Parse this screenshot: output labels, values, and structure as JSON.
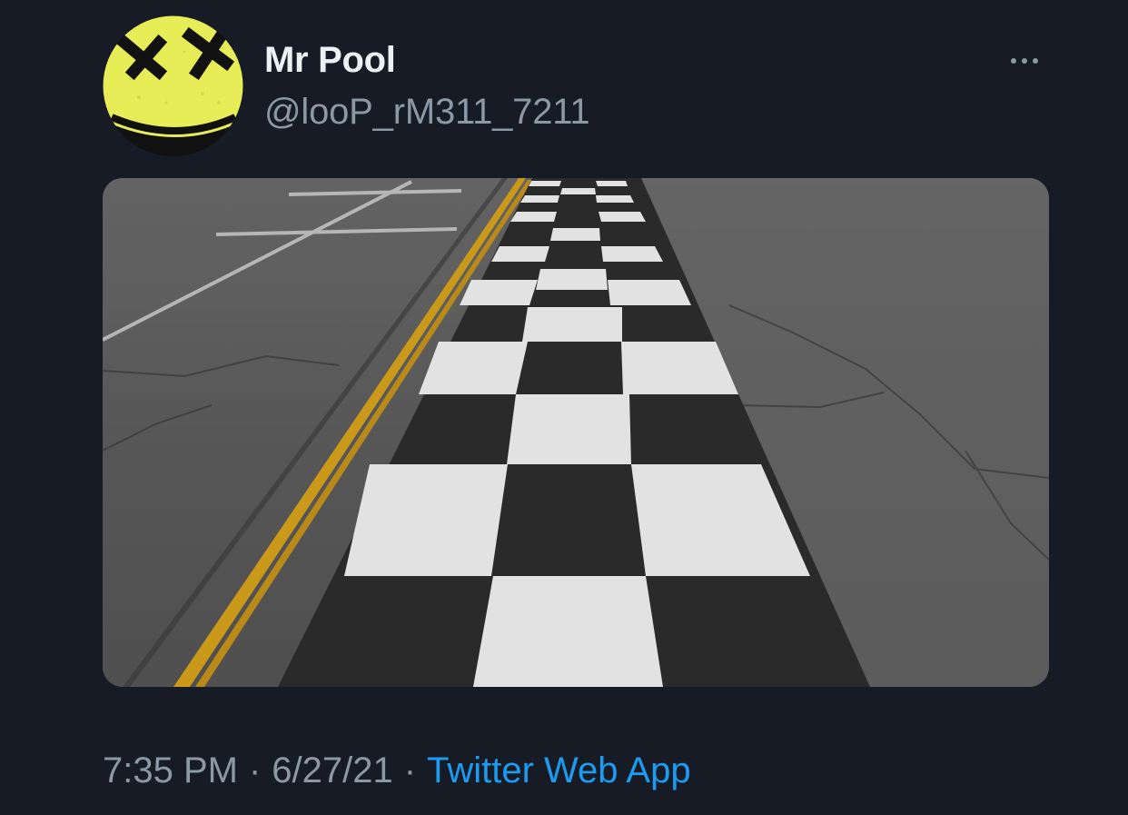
{
  "tweet": {
    "author": {
      "display_name": "Mr Pool",
      "handle": "@looP_rM311_7211",
      "avatar_icon": "yellow-smiley-face-icon"
    },
    "more_icon": "more-options-icon",
    "media": {
      "subject": "checkered-finish-line-photo"
    },
    "meta": {
      "time": "7:35 PM",
      "separator": "·",
      "date": "6/27/21",
      "source": "Twitter Web App"
    }
  },
  "colors": {
    "background": "#161b26",
    "name": "#eef1f4",
    "secondary_text": "#8b98a5",
    "link": "#1d9bf0",
    "avatar_yellow": "#e7ed56"
  }
}
